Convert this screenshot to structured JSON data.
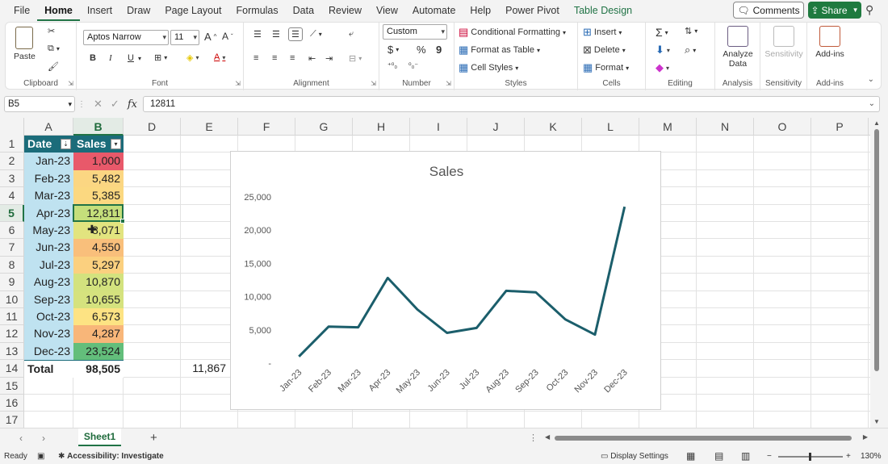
{
  "menu": {
    "tabs": [
      "File",
      "Home",
      "Insert",
      "Draw",
      "Page Layout",
      "Formulas",
      "Data",
      "Review",
      "View",
      "Automate",
      "Help",
      "Power Pivot",
      "Table Design"
    ],
    "comments_label": "Comments",
    "share_label": "Share"
  },
  "ribbon": {
    "clipboard": {
      "label": "Clipboard",
      "paste": "Paste"
    },
    "font": {
      "label": "Font",
      "name": "Aptos Narrow",
      "size": "11",
      "bold": "B",
      "italic": "I",
      "underline": "U"
    },
    "alignment": {
      "label": "Alignment"
    },
    "number": {
      "label": "Number",
      "format": "Custom",
      "currency": "$",
      "percent": "%",
      "comma": "9"
    },
    "styles": {
      "label": "Styles",
      "conditional": "Conditional Formatting",
      "format_table": "Format as Table",
      "cell_styles": "Cell Styles"
    },
    "cells": {
      "label": "Cells",
      "insert": "Insert",
      "delete": "Delete",
      "format": "Format"
    },
    "editing": {
      "label": "Editing"
    },
    "analysis": {
      "label": "Analysis",
      "analyze_line1": "Analyze",
      "analyze_line2": "Data"
    },
    "sensitivity": {
      "label": "Sensitivity",
      "button": "Sensitivity"
    },
    "addins": {
      "label": "Add-ins",
      "button": "Add-ins"
    }
  },
  "formula_bar": {
    "name_box": "B5",
    "fx": "fx",
    "value": "12811"
  },
  "columns": [
    "A",
    "B",
    "D",
    "E",
    "F",
    "G",
    "H",
    "I",
    "J",
    "K",
    "L",
    "M",
    "N",
    "O",
    "P"
  ],
  "rows": [
    "1",
    "2",
    "3",
    "4",
    "5",
    "6",
    "7",
    "8",
    "9",
    "10",
    "11",
    "12",
    "13",
    "14",
    "15",
    "16",
    "17"
  ],
  "table": {
    "headers": [
      "Date",
      "Sales"
    ],
    "rows": [
      {
        "date": "Jan-23",
        "sales": "1,000",
        "color": "#e8596a"
      },
      {
        "date": "Feb-23",
        "sales": "5,482",
        "color": "#fbd682"
      },
      {
        "date": "Mar-23",
        "sales": "5,385",
        "color": "#fbd880"
      },
      {
        "date": "Apr-23",
        "sales": "12,811",
        "color": "#c5df7b"
      },
      {
        "date": "May-23",
        "sales": "8,071",
        "color": "#e2e47f"
      },
      {
        "date": "Jun-23",
        "sales": "4,550",
        "color": "#f9bf7b"
      },
      {
        "date": "Jul-23",
        "sales": "5,297",
        "color": "#fbd07f"
      },
      {
        "date": "Aug-23",
        "sales": "10,870",
        "color": "#d3e27e"
      },
      {
        "date": "Sep-23",
        "sales": "10,655",
        "color": "#d5e27e"
      },
      {
        "date": "Oct-23",
        "sales": "6,573",
        "color": "#fde383"
      },
      {
        "date": "Nov-23",
        "sales": "4,287",
        "color": "#f8b679"
      },
      {
        "date": "Dec-23",
        "sales": "23,524",
        "color": "#63be7b"
      }
    ],
    "total_label": "Total",
    "total_value": "98,505"
  },
  "extra_cell": "11,867",
  "chart_data": {
    "type": "line",
    "title": "Sales",
    "categories": [
      "Jan-23",
      "Feb-23",
      "Mar-23",
      "Apr-23",
      "May-23",
      "Jun-23",
      "Jul-23",
      "Aug-23",
      "Sep-23",
      "Oct-23",
      "Nov-23",
      "Dec-23"
    ],
    "values": [
      1000,
      5482,
      5385,
      12811,
      8071,
      4550,
      5297,
      10870,
      10655,
      6573,
      4287,
      23524
    ],
    "y_ticks": [
      "-",
      "5,000",
      "10,000",
      "15,000",
      "20,000",
      "25,000"
    ],
    "ylim": [
      0,
      25000
    ],
    "line_color": "#1b5e6b",
    "grid": false,
    "legend": "none"
  },
  "sheet_tab": "Sheet1",
  "status": {
    "ready": "Ready",
    "accessibility": "Accessibility: Investigate",
    "display_settings": "Display Settings",
    "zoom": "130%"
  }
}
